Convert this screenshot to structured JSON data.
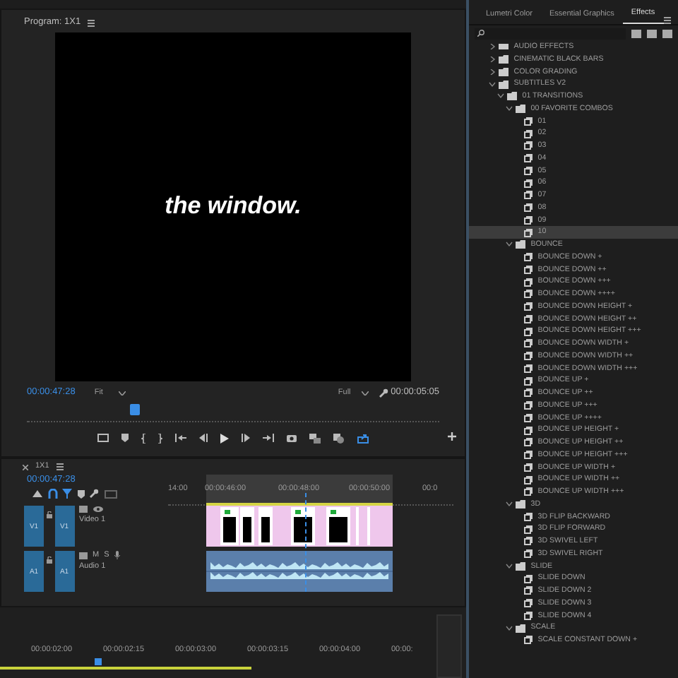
{
  "program_monitor": {
    "title": "Program: 1X1",
    "caption": "the window.",
    "timecode": "00:00:47:28",
    "zoom": "Fit",
    "resolution": "Full",
    "duration": "00:00:05:05",
    "playhead": {
      "level": 0.26
    }
  },
  "timeline": {
    "title": "1X1",
    "timecode": "00:00:47:28",
    "ruler": [
      "14:00",
      "00:00:46:00",
      "00:00:48:00",
      "00:00:50:00",
      "00:0"
    ],
    "tracks": [
      {
        "kind": "video",
        "source": "V1",
        "target": "V1",
        "name": "Video 1"
      },
      {
        "kind": "audio",
        "source": "A1",
        "target": "A1",
        "name": "Audio 1",
        "mute": "M",
        "solo": "S"
      }
    ]
  },
  "lower_panel": {
    "ruler": [
      "00:00:02:00",
      "00:00:02:15",
      "00:00:03:00",
      "00:00:03:15",
      "00:00:04:00",
      "00:00:"
    ]
  },
  "effects_panel": {
    "tabs": [
      {
        "label": "Lumetri Color",
        "selected": false
      },
      {
        "label": "Essential Graphics",
        "selected": false
      },
      {
        "label": "Effects",
        "selected": true
      }
    ],
    "tree": [
      {
        "label": "AUDIO EFFECTS",
        "kind": "bin",
        "expanded": false,
        "selected": false
      },
      {
        "label": "CINEMATIC BLACK BARS",
        "kind": "folder",
        "expanded": false,
        "selected": false
      },
      {
        "label": "COLOR GRADING",
        "kind": "folder",
        "expanded": false,
        "selected": false
      },
      {
        "label": "SUBTITLES V2",
        "kind": "folder",
        "expanded": true,
        "selected": false,
        "children": [
          {
            "label": "01 TRANSITIONS",
            "kind": "folder",
            "expanded": true,
            "selected": false,
            "children": [
              {
                "label": "00 FAVORITE COMBOS",
                "kind": "folder",
                "expanded": true,
                "selected": false,
                "children": [
                  {
                    "label": "01",
                    "kind": "preset",
                    "selected": false
                  },
                  {
                    "label": "02",
                    "kind": "preset",
                    "selected": false
                  },
                  {
                    "label": "03",
                    "kind": "preset",
                    "selected": false
                  },
                  {
                    "label": "04",
                    "kind": "preset",
                    "selected": false
                  },
                  {
                    "label": "05",
                    "kind": "preset",
                    "selected": false
                  },
                  {
                    "label": "06",
                    "kind": "preset",
                    "selected": false
                  },
                  {
                    "label": "07",
                    "kind": "preset",
                    "selected": false
                  },
                  {
                    "label": "08",
                    "kind": "preset",
                    "selected": false
                  },
                  {
                    "label": "09",
                    "kind": "preset",
                    "selected": false
                  },
                  {
                    "label": "10",
                    "kind": "preset",
                    "selected": true
                  }
                ]
              },
              {
                "label": "BOUNCE",
                "kind": "folder",
                "expanded": true,
                "selected": false,
                "children": [
                  {
                    "label": "BOUNCE DOWN +",
                    "kind": "preset",
                    "selected": false
                  },
                  {
                    "label": "BOUNCE DOWN ++",
                    "kind": "preset",
                    "selected": false
                  },
                  {
                    "label": "BOUNCE DOWN +++",
                    "kind": "preset",
                    "selected": false
                  },
                  {
                    "label": "BOUNCE DOWN ++++",
                    "kind": "preset",
                    "selected": false
                  },
                  {
                    "label": "BOUNCE DOWN HEIGHT +",
                    "kind": "preset",
                    "selected": false
                  },
                  {
                    "label": "BOUNCE DOWN HEIGHT ++",
                    "kind": "preset",
                    "selected": false
                  },
                  {
                    "label": "BOUNCE DOWN HEIGHT +++",
                    "kind": "preset",
                    "selected": false
                  },
                  {
                    "label": "BOUNCE DOWN WIDTH +",
                    "kind": "preset",
                    "selected": false
                  },
                  {
                    "label": "BOUNCE DOWN WIDTH ++",
                    "kind": "preset",
                    "selected": false
                  },
                  {
                    "label": "BOUNCE DOWN WIDTH +++",
                    "kind": "preset",
                    "selected": false
                  },
                  {
                    "label": "BOUNCE UP +",
                    "kind": "preset",
                    "selected": false
                  },
                  {
                    "label": "BOUNCE UP ++",
                    "kind": "preset",
                    "selected": false
                  },
                  {
                    "label": "BOUNCE UP +++",
                    "kind": "preset",
                    "selected": false
                  },
                  {
                    "label": "BOUNCE UP ++++",
                    "kind": "preset",
                    "selected": false
                  },
                  {
                    "label": "BOUNCE UP HEIGHT +",
                    "kind": "preset",
                    "selected": false
                  },
                  {
                    "label": "BOUNCE UP HEIGHT ++",
                    "kind": "preset",
                    "selected": false
                  },
                  {
                    "label": "BOUNCE UP HEIGHT +++",
                    "kind": "preset",
                    "selected": false
                  },
                  {
                    "label": "BOUNCE UP WIDTH +",
                    "kind": "preset",
                    "selected": false
                  },
                  {
                    "label": "BOUNCE UP WIDTH ++",
                    "kind": "preset",
                    "selected": false
                  },
                  {
                    "label": "BOUNCE UP WIDTH +++",
                    "kind": "preset",
                    "selected": false
                  }
                ]
              },
              {
                "label": "3D",
                "kind": "folder",
                "expanded": true,
                "selected": false,
                "children": [
                  {
                    "label": "3D FLIP BACKWARD",
                    "kind": "preset",
                    "selected": false
                  },
                  {
                    "label": "3D FLIP FORWARD",
                    "kind": "preset",
                    "selected": false
                  },
                  {
                    "label": "3D SWIVEL LEFT",
                    "kind": "preset",
                    "selected": false
                  },
                  {
                    "label": "3D SWIVEL RIGHT",
                    "kind": "preset",
                    "selected": false
                  }
                ]
              },
              {
                "label": "SLIDE",
                "kind": "folder",
                "expanded": true,
                "selected": false,
                "children": [
                  {
                    "label": "SLIDE DOWN",
                    "kind": "preset",
                    "selected": false
                  },
                  {
                    "label": "SLIDE DOWN 2",
                    "kind": "preset",
                    "selected": false
                  },
                  {
                    "label": "SLIDE DOWN 3",
                    "kind": "preset",
                    "selected": false
                  },
                  {
                    "label": "SLIDE DOWN 4",
                    "kind": "preset",
                    "selected": false
                  }
                ]
              },
              {
                "label": "SCALE",
                "kind": "folder",
                "expanded": true,
                "selected": false,
                "children": [
                  {
                    "label": "SCALE CONSTANT DOWN +",
                    "kind": "preset",
                    "selected": false
                  }
                ]
              }
            ]
          }
        ]
      }
    ]
  }
}
